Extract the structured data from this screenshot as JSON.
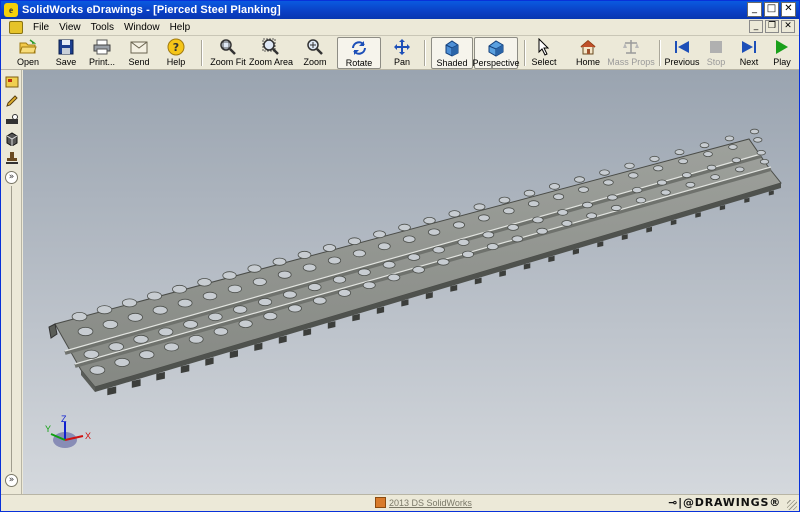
{
  "window": {
    "title": "SolidWorks eDrawings - [Pierced Steel Planking]",
    "controls": {
      "minimize": "_",
      "maximize": "□",
      "close": "✕"
    }
  },
  "menu": {
    "items": [
      "File",
      "View",
      "Tools",
      "Window",
      "Help"
    ],
    "mdi": {
      "minimize": "_",
      "restore": "❐",
      "close": "✕"
    }
  },
  "toolbar": {
    "open": "Open",
    "save": "Save",
    "print": "Print...",
    "send": "Send",
    "help": "Help",
    "zoom_fit": "Zoom Fit",
    "zoom_area": "Zoom Area",
    "zoom": "Zoom",
    "rotate": "Rotate",
    "pan": "Pan",
    "shaded": "Shaded",
    "perspective": "Perspective",
    "select": "Select",
    "home": "Home",
    "mass_props": "Mass Props",
    "previous": "Previous",
    "stop": "Stop",
    "next": "Next",
    "play": "Play"
  },
  "sidebar": {
    "expand": "»"
  },
  "triad": {
    "x": "X",
    "y": "Y",
    "z": "Z"
  },
  "status": {
    "copyright": "2013 DS SolidWorks",
    "brand": "⊸|@DRAWINGS®"
  },
  "colors": {
    "title_blue": "#0a3fc4",
    "viewport_top": "#9aa4b0",
    "viewport_bottom": "#d4d8dd",
    "steel": "#8d918d",
    "axis_x": "#d01010",
    "axis_y": "#10a010",
    "axis_z": "#1020d0"
  }
}
